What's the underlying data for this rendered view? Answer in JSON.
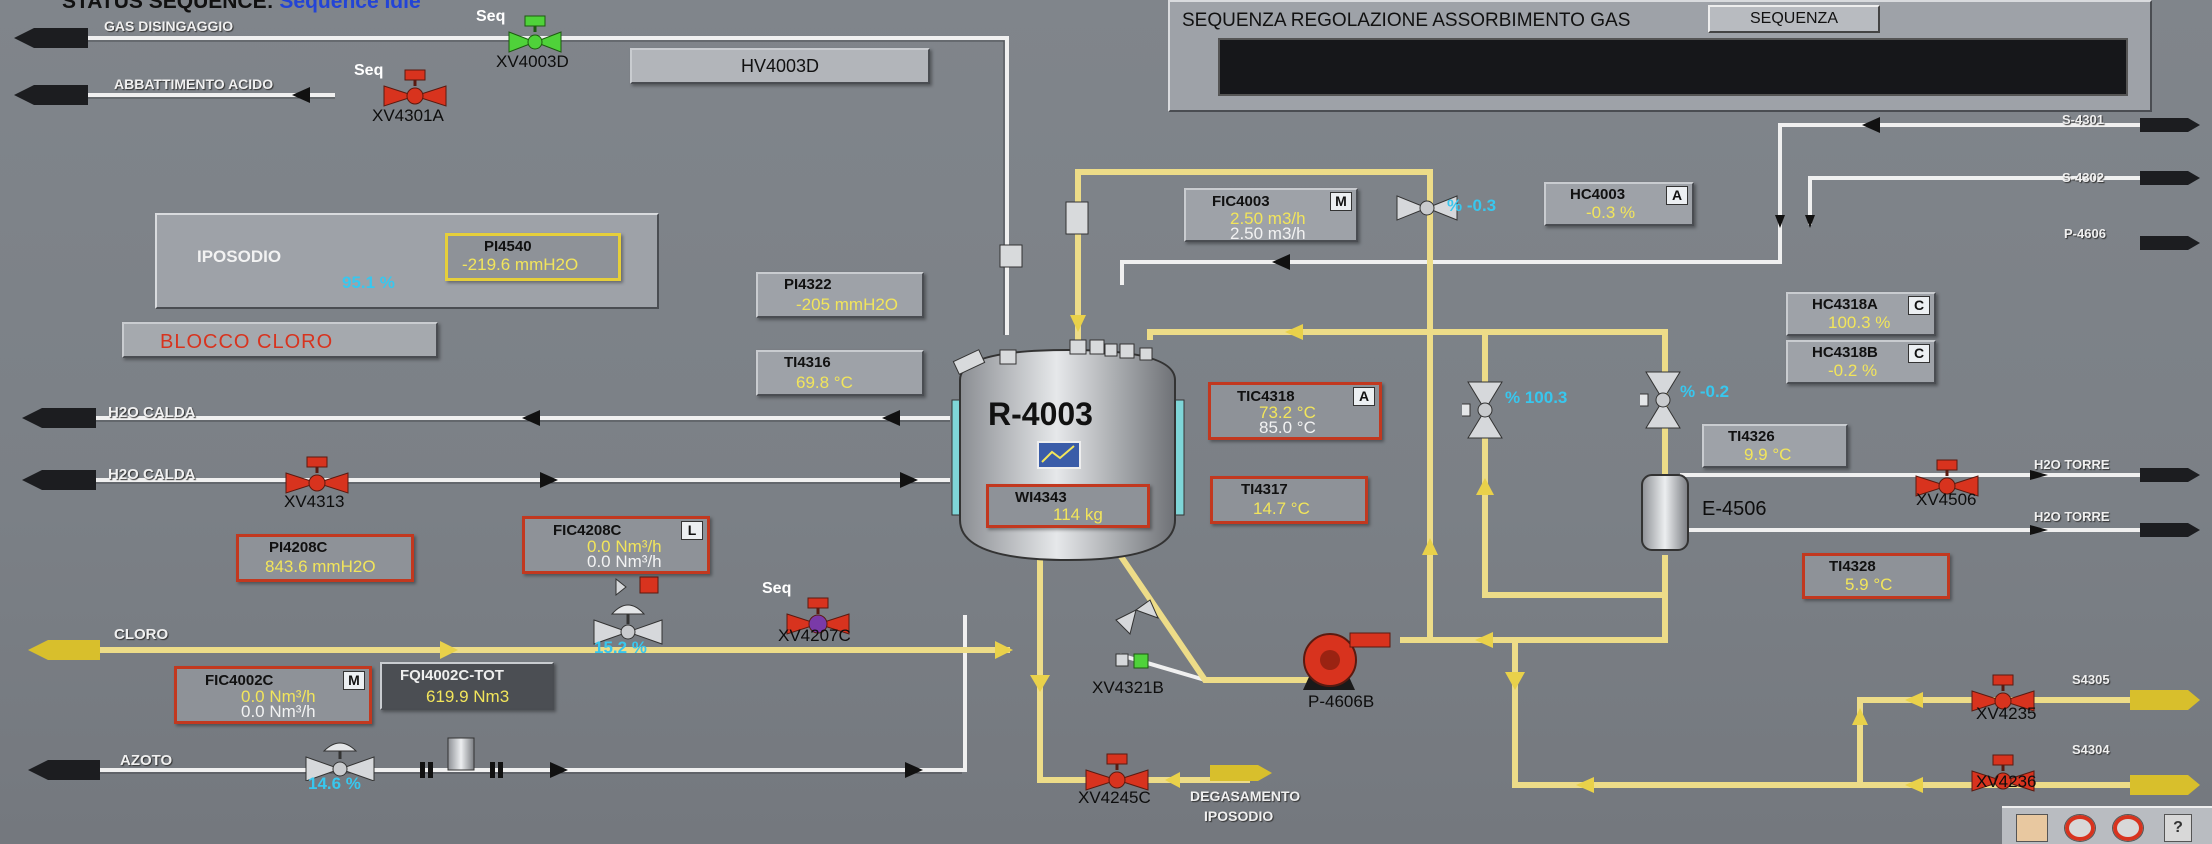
{
  "status": {
    "prefix": "STATUS SEQUENCE:",
    "value": "Sequence Idle"
  },
  "sequence_panel": {
    "title": "SEQUENZA REGOLAZIONE ASSORBIMENTO GAS",
    "button": "SEQUENZA"
  },
  "reactor": {
    "name": "R-4003"
  },
  "exchanger": {
    "name": "E-4506"
  },
  "pump": {
    "name": "P-4606B"
  },
  "hv_button": "HV4003D",
  "blocco_cloro": "BLOCCO CLORO",
  "iposodio_panel": {
    "label": "IPOSODIO",
    "valve_pct": "95.1 %",
    "tag": "PI4540",
    "value": "-219.6 mmH2O"
  },
  "lines": {
    "gas_disingaggio": "GAS DISINGAGGIO",
    "abbattimento_acido": "ABBATTIMENTO ACIDO",
    "h2o_calda_1": "H2O CALDA",
    "h2o_calda_2": "H2O CALDA",
    "cloro": "CLORO",
    "azoto": "AZOTO",
    "s4301": "S-4301",
    "s4302": "S-4302",
    "p4606": "P-4606",
    "h2o_torre_1": "H2O TORRE",
    "h2o_torre_2": "H2O TORRE",
    "s4305": "S4305",
    "s4304": "S4304",
    "degasamento": "DEGASAMENTO",
    "iposodio": "IPOSODIO"
  },
  "seq_label": "Seq",
  "valves": {
    "xv4003d": "XV4003D",
    "xv4301a": "XV4301A",
    "xv4313": "XV4313",
    "xv4207c": "XV4207C",
    "xv4321b": "XV4321B",
    "xv4245c": "XV4245C",
    "xv4506": "XV4506",
    "xv4235": "XV4235",
    "xv4236": "XV4236"
  },
  "control_pct": {
    "fic4003": "% -0.3",
    "tic4318": "% 100.3",
    "e4506": "% -0.2",
    "fic4208c": "15.2 %",
    "fic4002c": "14.6 %"
  },
  "instruments": {
    "pi4322": {
      "tag": "PI4322",
      "value": "-205 mmH2O"
    },
    "ti4316": {
      "tag": "TI4316",
      "value": "69.8 °C"
    },
    "wi4343": {
      "tag": "WI4343",
      "value": "114 kg"
    },
    "fic4003": {
      "tag": "FIC4003",
      "mode": "M",
      "pv": "2.50 m3/h",
      "sp": "2.50 m3/h"
    },
    "hc4003": {
      "tag": "HC4003",
      "mode": "A",
      "value": "-0.3 %"
    },
    "tic4318": {
      "tag": "TIC4318",
      "mode": "A",
      "pv": "73.2 °C",
      "sp": "85.0 °C"
    },
    "ti4317": {
      "tag": "TI4317",
      "value": "14.7 °C"
    },
    "hc4318a": {
      "tag": "HC4318A",
      "mode": "C",
      "value": "100.3 %"
    },
    "hc4318b": {
      "tag": "HC4318B",
      "mode": "C",
      "value": "-0.2 %"
    },
    "ti4326": {
      "tag": "TI4326",
      "value": "9.9 °C"
    },
    "ti4328": {
      "tag": "TI4328",
      "value": "5.9 °C"
    },
    "pi4208c": {
      "tag": "PI4208C",
      "value": "843.6 mmH2O"
    },
    "fic4208c": {
      "tag": "FIC4208C",
      "mode": "L",
      "pv": "0.0 Nm³/h",
      "sp": "0.0 Nm³/h"
    },
    "fic4002c": {
      "tag": "FIC4002C",
      "mode": "M",
      "pv": "0.0 Nm³/h",
      "sp": "0.0 Nm³/h"
    },
    "fqi4002c": {
      "tag": "FQI4002C-TOT",
      "value": "619.9 Nm3"
    }
  },
  "footer_icons": [
    "ack-icon",
    "alarm-silence-icon",
    "alarm-stop-icon",
    "help-icon"
  ],
  "footer_help": "?",
  "colors": {
    "valve_red": "#d8331e",
    "valve_green": "#4fd23a",
    "flow_yellow": "#e9d14a",
    "cyan_text": "#38c7ee",
    "value_yellow": "#f2e55b"
  }
}
